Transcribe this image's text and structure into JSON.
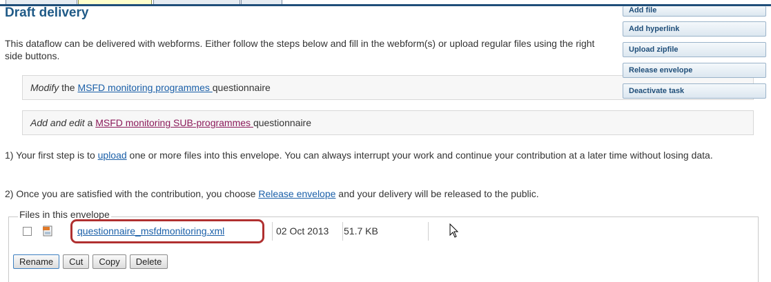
{
  "header": {
    "title": "Draft delivery"
  },
  "intro": "This dataflow can be delivered with webforms. Either follow the steps below and fill in the webform(s) or upload regular files using the right side buttons.",
  "questionnaires": [
    {
      "verb": "Modify",
      "middle": " the ",
      "link": "MSFD monitoring programmes ",
      "suffix": "questionnaire"
    },
    {
      "verb": "Add and edit",
      "middle": " a ",
      "link": "MSFD monitoring SUB-programmes ",
      "suffix": "questionnaire"
    }
  ],
  "steps": {
    "step1": {
      "prefix": "1) Your first step is to ",
      "link": "upload",
      "suffix": " one or more files into this envelope. You can always interrupt your work and continue your contribution at a later time without losing data."
    },
    "step2": {
      "prefix": "2) Once you are satisfied with the contribution, you choose ",
      "link": "Release envelope",
      "suffix": " and your delivery will be released to the public."
    }
  },
  "side_buttons": [
    "Add file",
    "Add hyperlink",
    "Upload zipfile",
    "Release envelope",
    "Deactivate task"
  ],
  "files_section": {
    "legend": "Files in this envelope",
    "files": [
      {
        "name": "questionnaire_msfdmonitoring.xml",
        "date": "02 Oct 2013",
        "size": "51.7 KB",
        "icon": "xml-file-icon"
      }
    ],
    "actions": [
      "Rename",
      "Cut",
      "Copy",
      "Delete"
    ]
  },
  "colors": {
    "title": "#1f5a87",
    "link": "#1a5fa8",
    "visited_link": "#8b1a5a",
    "highlight": "#b03030"
  }
}
